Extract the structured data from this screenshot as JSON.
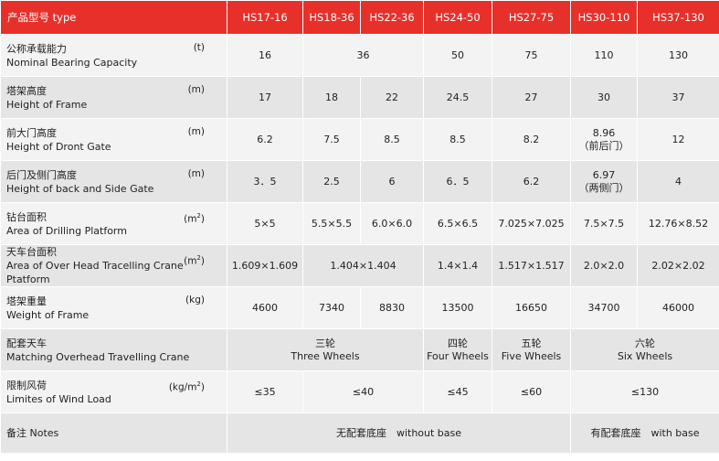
{
  "header": {
    "label": "产品型号 type",
    "models": [
      "HS17-16",
      "HS18-36",
      "HS22-36",
      "HS24-50",
      "HS27-75",
      "HS30-110",
      "HS37-130"
    ]
  },
  "rows": {
    "capacity": {
      "zh": "公称承载能力",
      "en": "Nominal Bearing Capacity",
      "unit": "(t)",
      "values": [
        "16",
        "36",
        "50",
        "75",
        "110",
        "130"
      ]
    },
    "height": {
      "zh": "塔架高度",
      "en": "Height of Frame",
      "unit": "(m)",
      "values": [
        "17",
        "18",
        "22",
        "24.5",
        "27",
        "30",
        "37"
      ]
    },
    "front_gate": {
      "zh": "前大门高度",
      "en": "Height of Dront Gate",
      "unit": "(m)",
      "values": [
        "6.2",
        "7.5",
        "8.5",
        "8.5",
        "8.2",
        "8.96",
        "12"
      ],
      "note": "（前后门）"
    },
    "back_gate": {
      "zh": "后门及侧门高度",
      "en": "Height of back and Side Gate",
      "unit": "(m)",
      "values": [
        "3．5",
        "2.5",
        "6",
        "6．5",
        "6.2",
        "6.97",
        "4"
      ],
      "note": "（两侧门）"
    },
    "drilling": {
      "zh": "钻台面积",
      "en": "Area of Drilling Platform",
      "unit": "(m",
      "unit_sup": "2",
      "unit_end": ")",
      "values": [
        "5×5",
        "5.5×5.5",
        "6.0×6.0",
        "6.5×6.5",
        "7.025×7.025",
        "7.5×7.5",
        "12.76×8.52"
      ]
    },
    "crane_platform": {
      "zh": "天车台面积",
      "en": "Area of Over Head Tracelling Crane Ptatform",
      "unit": "(m",
      "unit_sup": "2",
      "unit_end": ")",
      "values": [
        "1.609×1.609",
        "1.404×1.404",
        "1.4×1.4",
        "1.517×1.517",
        "2.0×2.0",
        "2.02×2.02"
      ]
    },
    "weight": {
      "zh": "塔架重量",
      "en": "Weight of Frame",
      "unit": "(kg)",
      "values": [
        "4600",
        "7340",
        "8830",
        "13500",
        "16650",
        "34700",
        "46000"
      ]
    },
    "crane": {
      "zh": "配套天车",
      "en": "Matching Overhead Travelling Crane",
      "values": [
        {
          "zh": "三轮",
          "en": "Three Wheels"
        },
        {
          "zh": "四轮",
          "en": "Four Wheels"
        },
        {
          "zh": "五轮",
          "en": "Five Wheels"
        },
        {
          "zh": "六轮",
          "en": "Six Wheels"
        }
      ]
    },
    "wind": {
      "zh": "限制风荷",
      "en": "Limites of Wind Load",
      "unit": "(kg/m",
      "unit_sup": "2",
      "unit_end": ")",
      "values": [
        "≤35",
        "≤40",
        "≤45",
        "≤60",
        "≤130"
      ]
    },
    "notes": {
      "label": "备注  Notes",
      "without_base": "无配套底座　without base",
      "with_base": "有配套底座　with base"
    }
  },
  "colors": {
    "header_bg": "#e8302a",
    "row_light": "#f3f3f3",
    "row_dark": "#e5e5e5"
  }
}
